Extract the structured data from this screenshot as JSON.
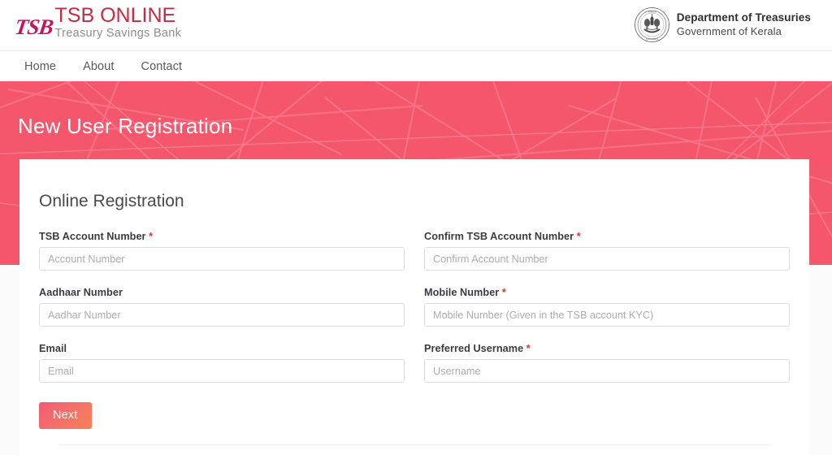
{
  "header": {
    "brand_mark": "TSB",
    "brand_title": "TSB ONLINE",
    "brand_subtitle": "Treasury Savings Bank",
    "gov_title": "Department of Treasuries",
    "gov_subtitle": "Government of Kerala",
    "emblem_icon": "kerala-state-emblem-icon"
  },
  "nav": {
    "items": [
      {
        "label": "Home"
      },
      {
        "label": "About"
      },
      {
        "label": "Contact"
      }
    ]
  },
  "banner": {
    "title": "New User Registration",
    "background_color": "#f4566c"
  },
  "card": {
    "title": "Online Registration",
    "fields": [
      {
        "label": "TSB Account Number",
        "required": true,
        "required_mark": "*",
        "placeholder": "Account Number",
        "value": "",
        "name": "tsb-account-number-input"
      },
      {
        "label": "Confirm TSB Account Number",
        "required": true,
        "required_mark": "*",
        "placeholder": "Confirm Account Number",
        "value": "",
        "name": "confirm-tsb-account-number-input"
      },
      {
        "label": "Aadhaar Number",
        "required": false,
        "required_mark": "",
        "placeholder": "Aadhar Number",
        "value": "",
        "name": "aadhaar-number-input"
      },
      {
        "label": "Mobile Number",
        "required": true,
        "required_mark": "*",
        "placeholder": "Mobile Number (Given in the TSB account KYC)",
        "value": "",
        "name": "mobile-number-input"
      },
      {
        "label": "Email",
        "required": false,
        "required_mark": "",
        "placeholder": "Email",
        "value": "",
        "name": "email-input"
      },
      {
        "label": "Preferred Username",
        "required": true,
        "required_mark": "*",
        "placeholder": "Username",
        "value": "",
        "name": "preferred-username-input"
      }
    ],
    "next_button": "Next"
  },
  "colors": {
    "accent_pink": "#f4566c",
    "brand_crimson": "#c62b44",
    "required_red": "#e03030",
    "button_gradient_start": "#f25b72",
    "button_gradient_end": "#f58157"
  }
}
